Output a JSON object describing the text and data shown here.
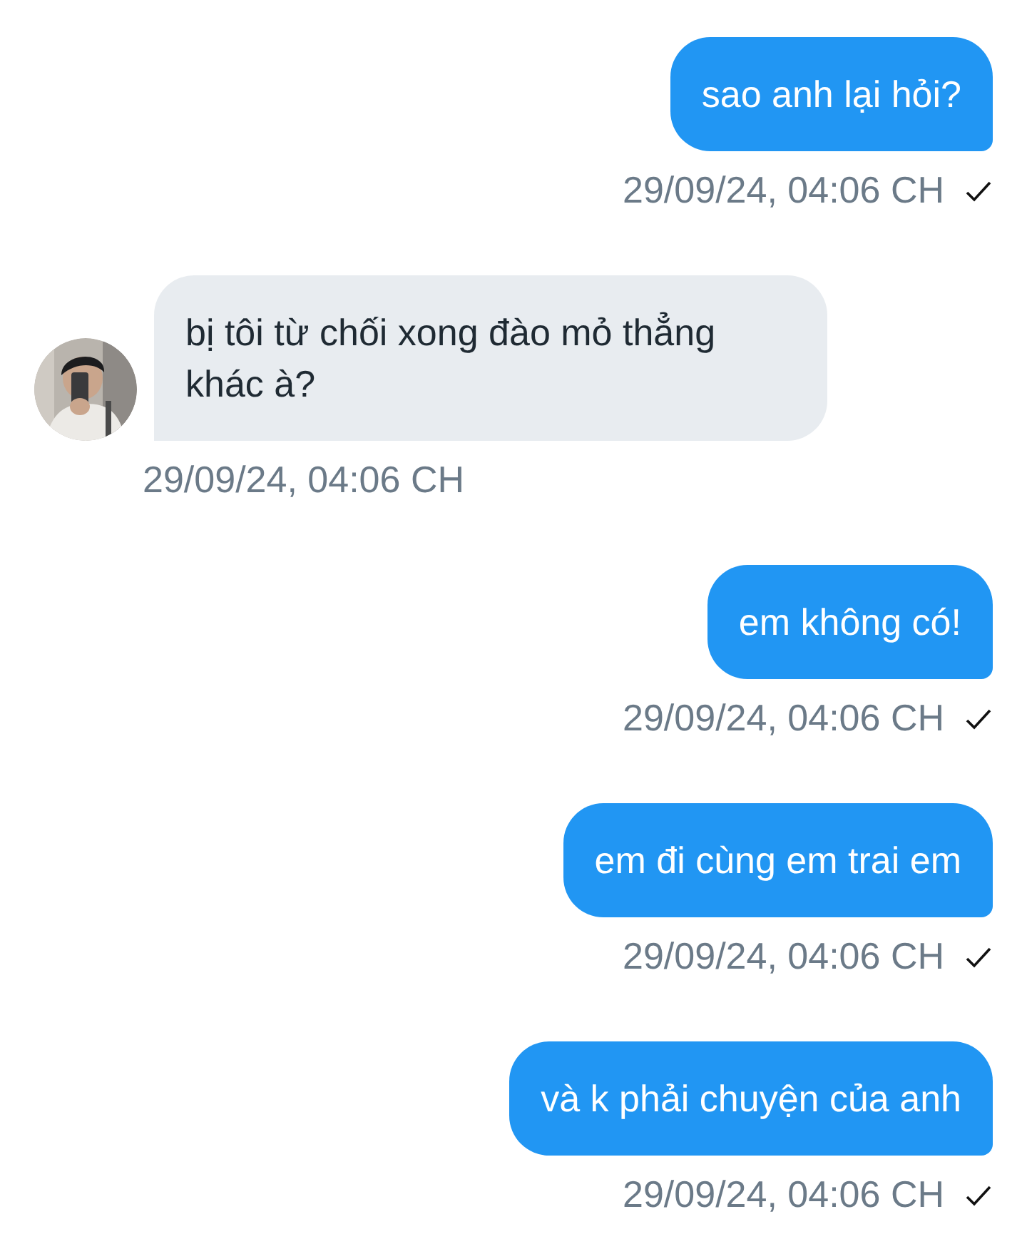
{
  "messages": [
    {
      "kind": "sent",
      "text": "sao anh lại hỏi?",
      "time": "29/09/24, 04:06 CH",
      "delivered": true
    },
    {
      "kind": "received",
      "text": "bị tôi từ chối xong đào mỏ thẳng khác à?",
      "time": "29/09/24, 04:06 CH"
    },
    {
      "kind": "sent",
      "text": "em không có!",
      "time": "29/09/24, 04:06 CH",
      "delivered": true
    },
    {
      "kind": "sent",
      "text": "em đi cùng em trai em",
      "time": "29/09/24, 04:06 CH",
      "delivered": true
    },
    {
      "kind": "sent",
      "text": "và k phải chuyện của anh",
      "time": "29/09/24, 04:06 CH",
      "delivered": true
    }
  ]
}
